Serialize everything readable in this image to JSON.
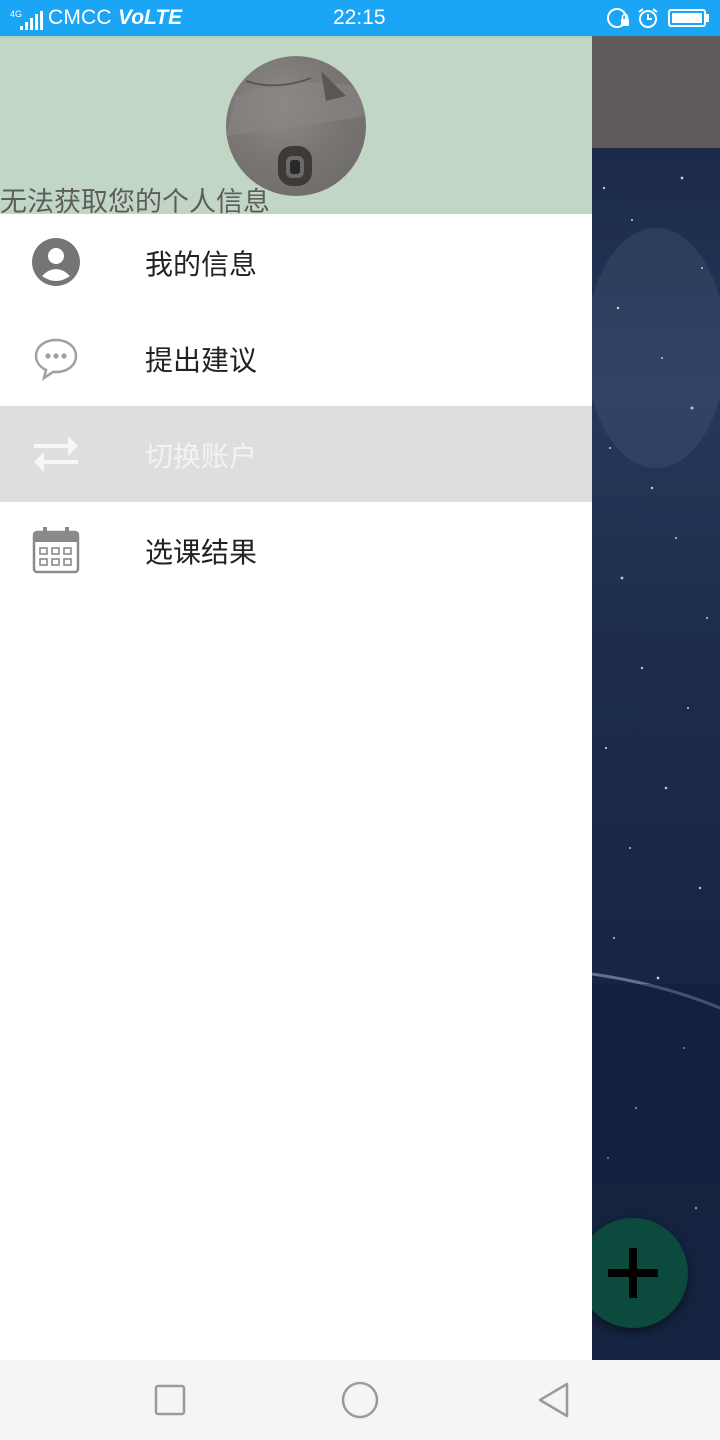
{
  "status_bar": {
    "network": "4G",
    "carrier": "CMCC",
    "volte": "VoLTE",
    "time": "22:15",
    "icons": [
      "signal-icon",
      "rotation-lock-icon",
      "alarm-icon",
      "battery-icon"
    ]
  },
  "drawer": {
    "header": {
      "message": "无法获取您的个人信息",
      "background": "#c2d6c6"
    },
    "menu": [
      {
        "label": "我的信息",
        "icon": "account-circle-icon",
        "selected": false
      },
      {
        "label": "提出建议",
        "icon": "chat-bubble-icon",
        "selected": false
      },
      {
        "label": "切换账户",
        "icon": "swap-arrows-icon",
        "selected": true
      },
      {
        "label": "选课结果",
        "icon": "calendar-icon",
        "selected": false
      }
    ]
  },
  "background_app": {
    "fab_icon": "plus-icon",
    "toolbar_color": "#5f5b5b",
    "fab_color": "#0b4a3c"
  },
  "nav_bar": {
    "buttons": [
      "recent-apps-icon",
      "home-icon",
      "back-icon"
    ]
  },
  "colors": {
    "status_bar": "#1aa6f4",
    "selected_item": "#dedede"
  }
}
